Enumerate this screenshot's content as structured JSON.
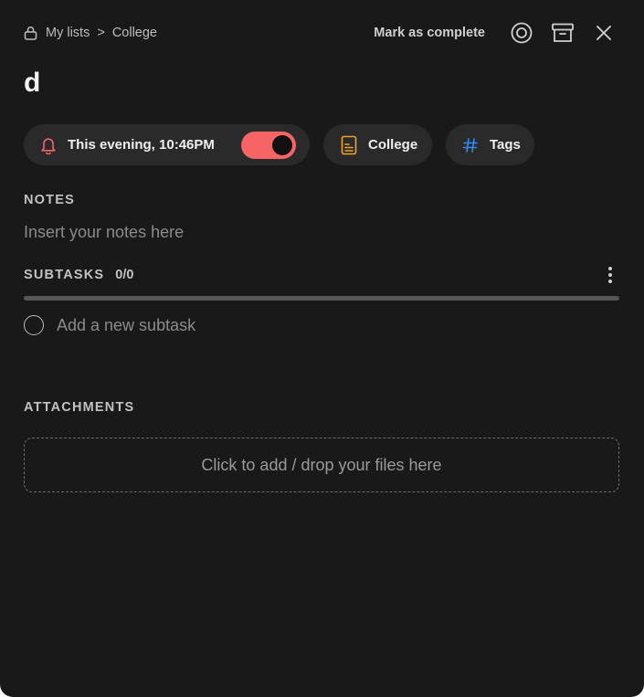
{
  "breadcrumb": {
    "root": "My lists",
    "separator": ">",
    "current": "College"
  },
  "header": {
    "mark_complete_label": "Mark as complete",
    "icons": [
      "target-icon",
      "archive-icon",
      "close-icon"
    ]
  },
  "task": {
    "title": "d"
  },
  "chips": {
    "reminder": {
      "label": "This evening, 10:46PM",
      "enabled": true,
      "icon": "bell-icon",
      "accent": "#f66466"
    },
    "list": {
      "label": "College",
      "icon": "document-icon",
      "accent": "#f0a22f"
    },
    "tags": {
      "label": "Tags",
      "icon": "hash-icon",
      "accent": "#2f8cf0"
    }
  },
  "notes": {
    "heading": "NOTES",
    "placeholder": "Insert your notes here"
  },
  "subtasks": {
    "heading": "SUBTASKS",
    "count": "0/0",
    "progress": 0,
    "add_placeholder": "Add a new subtask"
  },
  "attachments": {
    "heading": "ATTACHMENTS",
    "dropzone_label": "Click to add / drop your files here"
  }
}
